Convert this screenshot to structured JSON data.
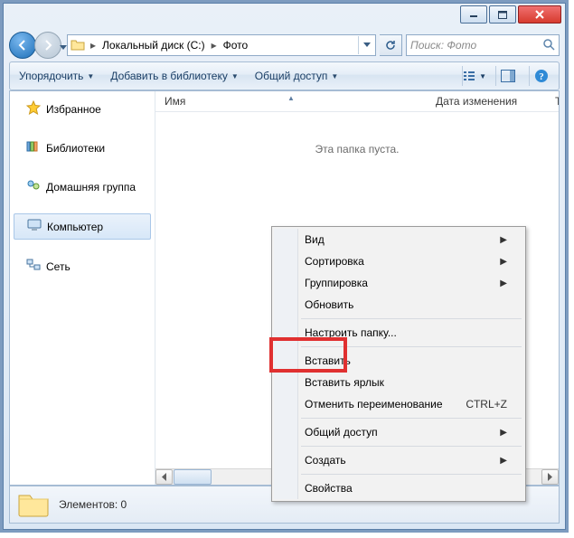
{
  "breadcrumb": {
    "seg1": "Локальный диск (C:)",
    "seg2": "Фото"
  },
  "search": {
    "placeholder": "Поиск: Фото"
  },
  "toolbar": {
    "organize": "Упорядочить",
    "add_to_library": "Добавить в библиотеку",
    "share": "Общий доступ"
  },
  "sidebar": {
    "favorites": "Избранное",
    "libraries": "Библиотеки",
    "homegroup": "Домашняя группа",
    "computer": "Компьютер",
    "network": "Сеть"
  },
  "columns": {
    "name": "Имя",
    "date": "Дата изменения",
    "type": "Тип"
  },
  "content": {
    "empty": "Эта папка пуста."
  },
  "status": {
    "items": "Элементов: 0"
  },
  "ctx": {
    "view": "Вид",
    "sort": "Сортировка",
    "group": "Группировка",
    "refresh": "Обновить",
    "customize": "Настроить папку...",
    "paste": "Вставить",
    "paste_shortcut": "Вставить ярлык",
    "undo_rename": "Отменить переименование",
    "undo_shortcut": "CTRL+Z",
    "share": "Общий доступ",
    "new": "Создать",
    "properties": "Свойства"
  }
}
